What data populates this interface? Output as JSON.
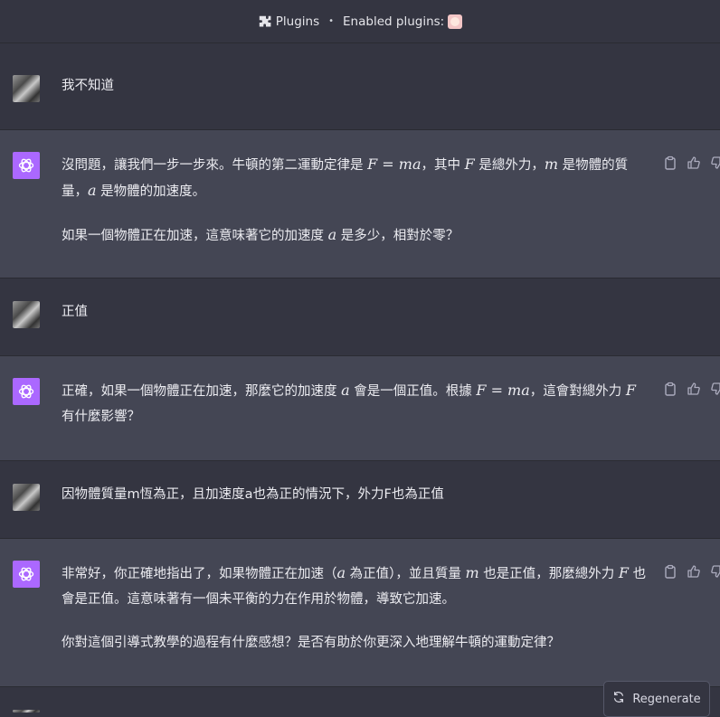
{
  "topbar": {
    "plugins_label": "Plugins",
    "separator": "•",
    "enabled_label": "Enabled plugins:"
  },
  "messages": [
    {
      "role": "user",
      "text": "我不知道"
    },
    {
      "role": "assistant",
      "p1_a": "沒問題，讓我們一步一步來。牛頓的第二運動定律是 ",
      "p1_m1": "F = ma",
      "p1_b": "，其中 ",
      "p1_m2": "F",
      "p1_c": " 是總外力，",
      "p1_m3": "m",
      "p1_d": " 是物體的質量，",
      "p1_m4": "a",
      "p1_e": " 是物體的加速度。",
      "p2_a": "如果一個物體正在加速，這意味著它的加速度 ",
      "p2_m1": "a",
      "p2_b": " 是多少，相對於零？"
    },
    {
      "role": "user",
      "text": "正值"
    },
    {
      "role": "assistant",
      "p1_a": "正確，如果一個物體正在加速，那麼它的加速度 ",
      "p1_m1": "a",
      "p1_b": " 會是一個正值。根據 ",
      "p1_m2": "F = ma",
      "p1_c": "，這會對總外力 ",
      "p1_m3": "F",
      "p1_d": " 有什麼影響？"
    },
    {
      "role": "user",
      "text": "因物體質量m恆為正，且加速度a也為正的情況下，外力F也為正值"
    },
    {
      "role": "assistant",
      "p1_a": "非常好，你正確地指出了，如果物體正在加速（",
      "p1_m1": "a",
      "p1_b": " 為正值），並且質量 ",
      "p1_m2": "m",
      "p1_c": " 也是正值，那麼總外力 ",
      "p1_m3": "F",
      "p1_d": " 也會是正值。這意味著有一個未平衡的力在作用於物體，導致它加速。",
      "p2_a": "你對這個引導式教學的過程有什麼感想？是否有助於你更深入地理解牛頓的運動定律？"
    }
  ],
  "regenerate_label": "Regenerate",
  "icons": {
    "plugin": "puzzle-icon",
    "copy": "clipboard-icon",
    "like": "thumbs-up-icon",
    "dislike": "thumbs-down-icon",
    "regen": "refresh-icon",
    "gpt": "openai-logo"
  },
  "colors": {
    "assistant_bg": "#444654",
    "user_bg": "#343541",
    "gpt_avatar": "#ab68ff"
  }
}
